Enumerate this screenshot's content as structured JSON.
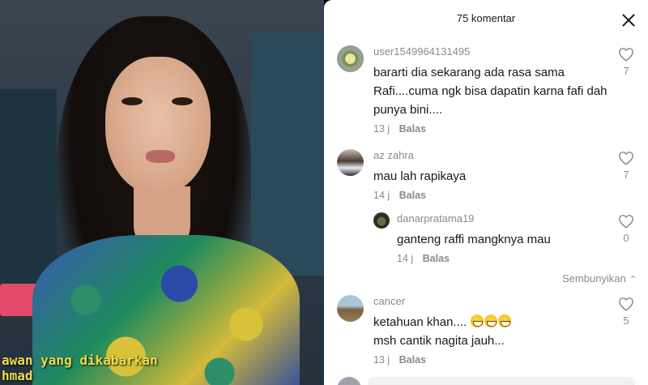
{
  "video": {
    "caption_line1": "awan yang dikabarkan",
    "caption_line2": "hmad"
  },
  "panel": {
    "title": "75 komentar",
    "hide_label": "Sembunyikan"
  },
  "comments": [
    {
      "username": "user1549964131495",
      "text_lines": [
        "bararti dia sekarang ada rasa sama",
        "Rafi....cuma ngk bisa dapatin karna fafi dah",
        "punya bini...."
      ],
      "time": "13 j",
      "reply_label": "Balas",
      "likes": "7"
    },
    {
      "username": "az zahra",
      "text_lines": [
        "mau lah rapikaya"
      ],
      "time": "14 j",
      "reply_label": "Balas",
      "likes": "7"
    },
    {
      "username": "danarpratama19",
      "text_lines": [
        "ganteng raffi mangknya mau"
      ],
      "time": "14 j",
      "reply_label": "Balas",
      "likes": "0"
    },
    {
      "username": "cancer",
      "text_lines": [
        "ketahuan khan....",
        "msh cantik nagita jauh..."
      ],
      "time": "13 j",
      "reply_label": "Balas",
      "likes": "5"
    }
  ],
  "icons": {
    "like": "heart-outline-icon",
    "close": "close-icon",
    "hide": "chevron-up-icon",
    "emoji": "grinning-face-emoji"
  },
  "colors": {
    "text": "#161823",
    "muted": "#8a8b91",
    "caption": "#ecdc52"
  }
}
